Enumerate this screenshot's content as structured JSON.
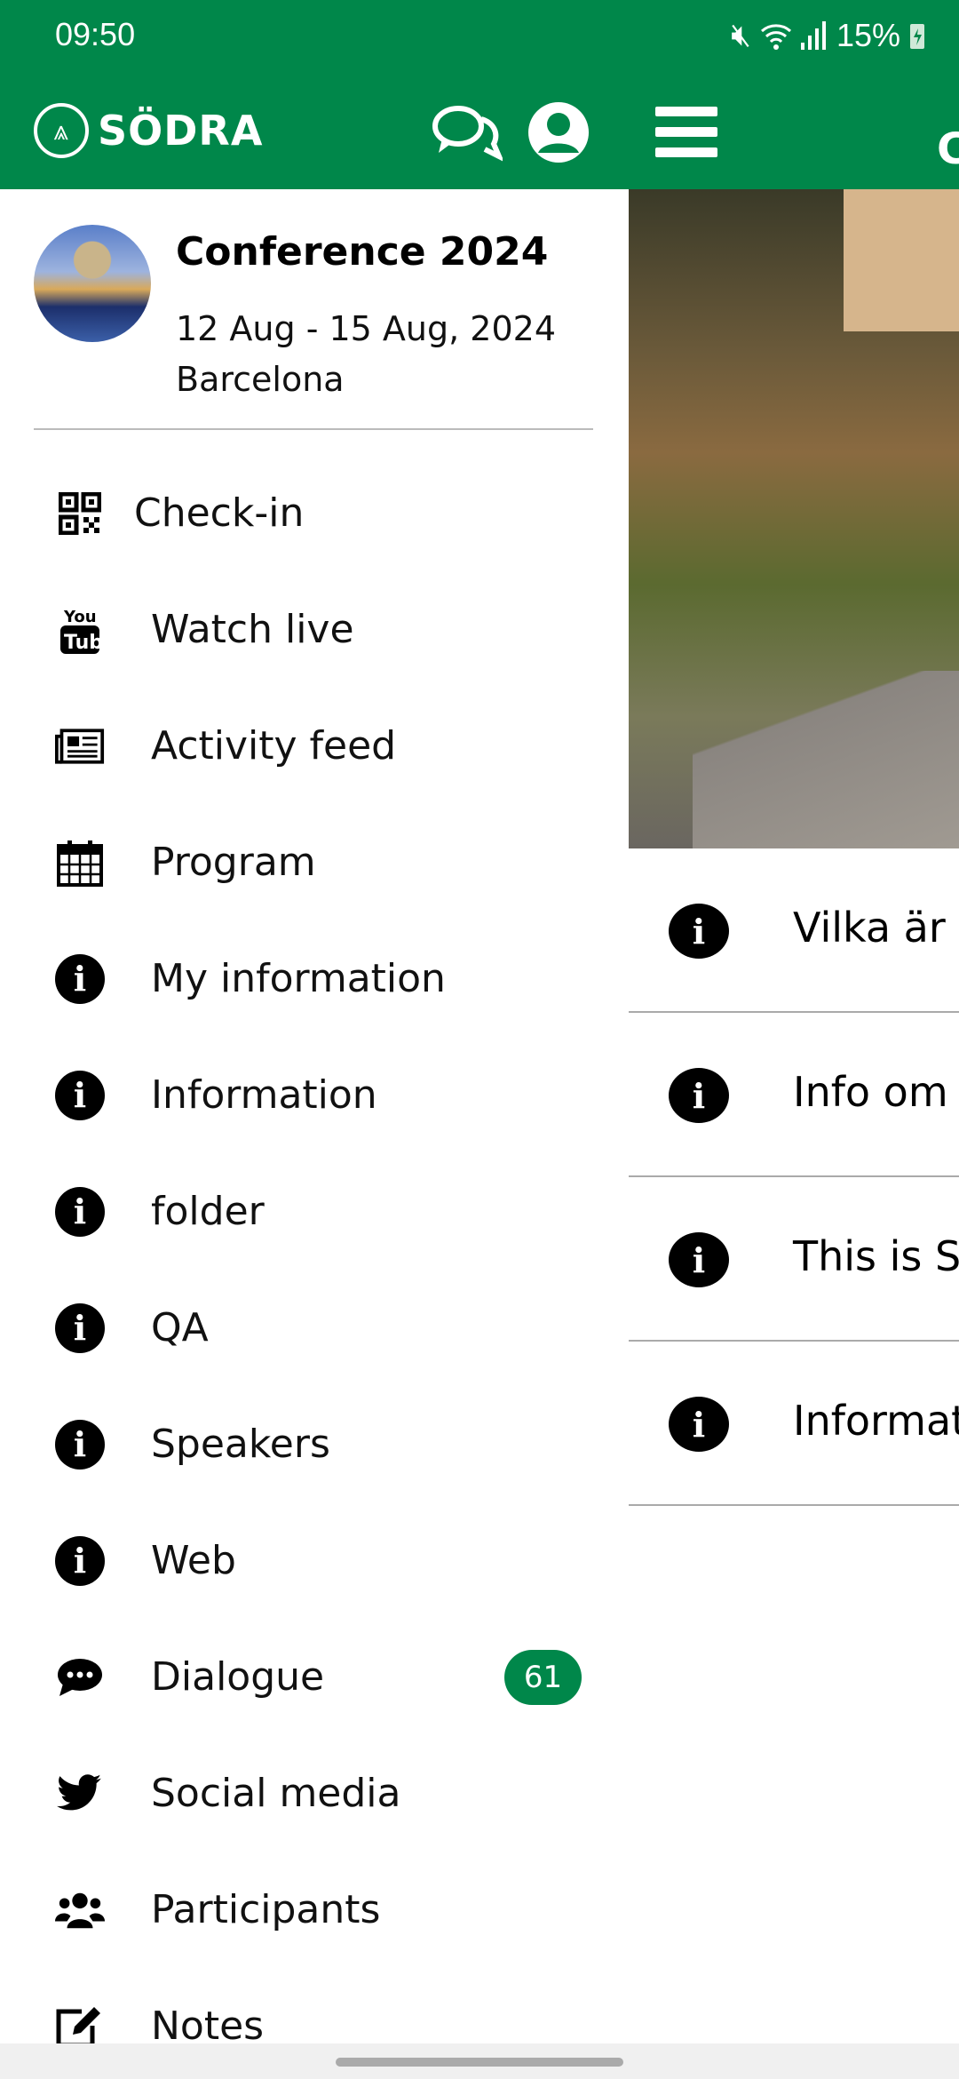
{
  "status_bar": {
    "time": "09:50",
    "battery": "15%",
    "icons": [
      "mute-icon",
      "wifi-icon",
      "signal-icon",
      "battery-charging-icon"
    ]
  },
  "app_bar": {
    "logo_text": "SÖDRA",
    "right_title_partial": "C",
    "icons": [
      "chat-icon",
      "user-icon",
      "hamburger-menu-icon"
    ]
  },
  "event": {
    "title": "Conference 2024",
    "dates": "12 Aug - 15 Aug, 2024",
    "location": "Barcelona"
  },
  "menu": [
    {
      "label": "Check-in",
      "icon": "qr-code-icon"
    },
    {
      "label": "Watch live",
      "icon": "youtube-icon"
    },
    {
      "label": "Activity feed",
      "icon": "newspaper-icon"
    },
    {
      "label": "Program",
      "icon": "calendar-icon"
    },
    {
      "label": "My information",
      "icon": "info-icon"
    },
    {
      "label": "Information",
      "icon": "info-icon"
    },
    {
      "label": "folder",
      "icon": "info-icon"
    },
    {
      "label": "QA",
      "icon": "info-icon"
    },
    {
      "label": "Speakers",
      "icon": "info-icon"
    },
    {
      "label": "Web",
      "icon": "info-icon"
    },
    {
      "label": "Dialogue",
      "icon": "comment-icon",
      "badge": "61"
    },
    {
      "label": "Social media",
      "icon": "twitter-icon"
    },
    {
      "label": "Participants",
      "icon": "users-icon"
    },
    {
      "label": "Notes",
      "icon": "edit-icon"
    }
  ],
  "background_list": [
    {
      "label": "Vilka är S"
    },
    {
      "label": "Info om ."
    },
    {
      "label": "This is Sö"
    },
    {
      "label": "Informat"
    }
  ],
  "colors": {
    "brand": "#00874a"
  }
}
